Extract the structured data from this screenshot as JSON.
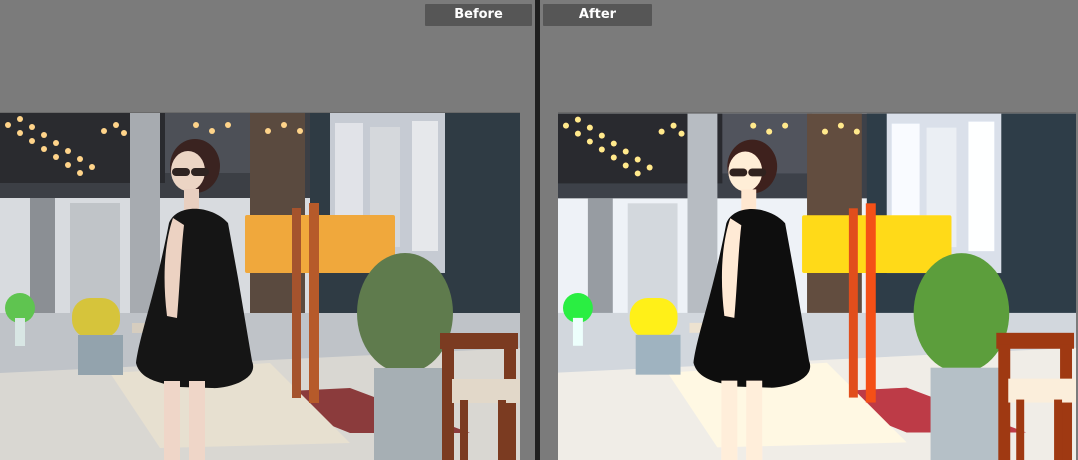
{
  "labels": {
    "before": "Before",
    "after": "After"
  },
  "colors": {
    "background": "#7b7b7b",
    "divider": "#1f1f1f",
    "label_bg": "#565656",
    "label_text": "#ffffff"
  }
}
